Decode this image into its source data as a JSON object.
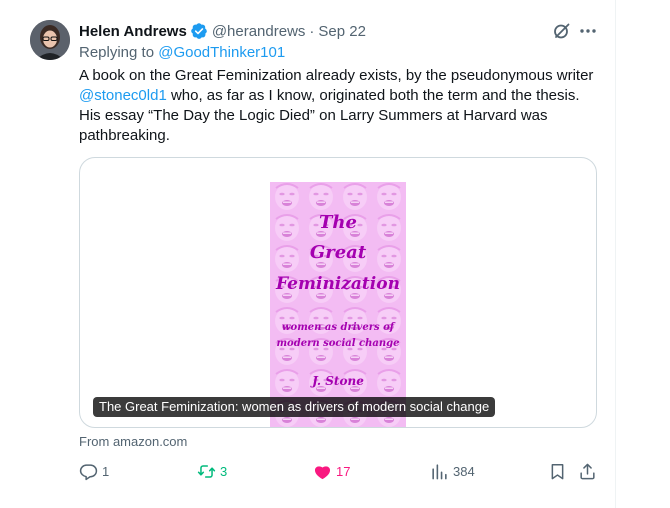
{
  "tweet": {
    "author_name": "Helen Andrews",
    "handle": "@herandrews",
    "separator": "·",
    "date": "Sep 22",
    "replying_prefix": "Replying to ",
    "replying_to": "@GoodThinker101",
    "text_part1": "A book on the Great Feminization already exists, by the pseudonymous writer ",
    "text_mention": "@stonec0ld1",
    "text_part2": " who, as far as I know, originated both the term and the thesis. His essay “The Day the Logic Died” on Larry Summers at Harvard was pathbreaking."
  },
  "card": {
    "cover": {
      "title_line1": "The",
      "title_line2": "Great",
      "title_line3": "Feminization",
      "subtitle_line1": "women as drivers of",
      "subtitle_line2": "modern social change",
      "author": "J. Stone"
    },
    "caption": "The Great Feminization: women as drivers of modern social change",
    "source": "From amazon.com"
  },
  "actions": {
    "reply_count": "1",
    "retweet_count": "3",
    "like_count": "17",
    "view_count": "384"
  },
  "colors": {
    "accent": "#1d9bf0",
    "retweet": "#00ba7c",
    "like": "#f91880",
    "muted": "#536471",
    "cover_background": "#f1b6f1",
    "cover_text": "#a400b0"
  },
  "icons": [
    "avatar",
    "verified-badge-icon",
    "grok-icon",
    "more-icon",
    "reply-icon",
    "retweet-icon",
    "heart-icon",
    "views-icon",
    "bookmark-icon",
    "share-icon"
  ]
}
